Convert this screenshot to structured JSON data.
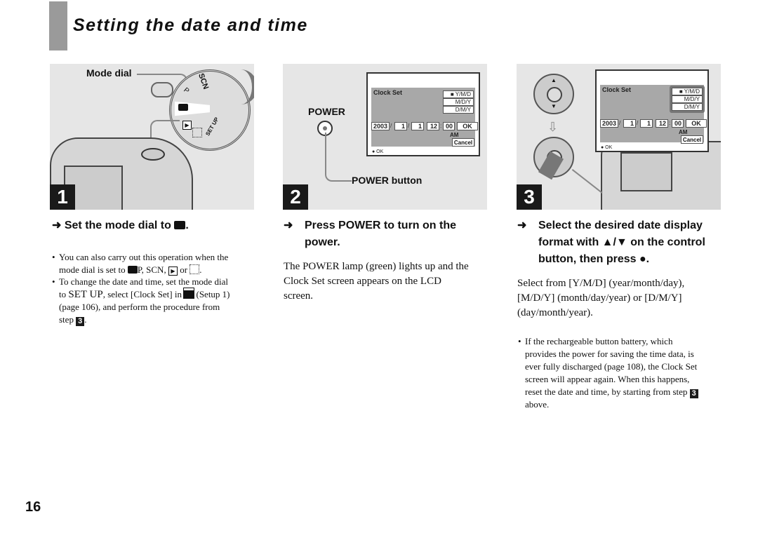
{
  "page": {
    "title": "Setting the date and time",
    "page_number": "16"
  },
  "steps": [
    {
      "number": "1",
      "illustration_label": "Mode dial",
      "dial_labels": [
        "SCN",
        "P",
        "SET UP"
      ],
      "heading": "Set the mode dial to",
      "heading_icon": "camera-icon",
      "heading_end": ".",
      "bullets": [
        {
          "line1": "You can also carry out this operation when the",
          "line2": "mode dial is set to",
          "line2_rest": "P, SCN,",
          "line2_or": "or",
          "line2_end": "."
        },
        {
          "line1": "To change the date and time, set the mode dial",
          "line2a": "to",
          "line2_setup": "SET UP",
          "line2b": ", select [Clock Set] in",
          "line2c": "(Setup 1)",
          "line3": "(page 106), and perform the procedure from",
          "line4": "step",
          "step_ref": "3",
          "line4_end": "."
        }
      ]
    },
    {
      "number": "2",
      "power_label": "POWER",
      "power_button_label": "POWER button",
      "heading_line1": "Press POWER to turn on the",
      "heading_line2": "power.",
      "body": [
        "The POWER lamp (green) lights up and the",
        "Clock Set screen appears on the LCD",
        "screen."
      ]
    },
    {
      "number": "3",
      "heading_lines": [
        "Select the desired date display",
        "format with ▲/▼ on the control",
        "button, then press ●."
      ],
      "body": [
        "Select from [Y/M/D] (year/month/day),",
        "[M/D/Y] (month/day/year) or [D/M/Y]",
        "(day/month/year)."
      ],
      "note": {
        "lines": [
          "If the rechargeable button battery, which",
          "provides the power for saving the time data, is",
          "ever fully discharged (page 108), the Clock Set",
          "screen will appear again. When this happens,",
          "reset the date and time, by starting from step"
        ],
        "step_ref": "3",
        "last_line": "above."
      }
    }
  ],
  "clock_set_screen": {
    "title": "Clock Set",
    "formats": [
      "■ Y/M/D",
      "M/D/Y",
      "D/M/Y"
    ],
    "selected_format": "Y/M/D",
    "year": "2003",
    "month": "1",
    "day": "1",
    "hour": "12",
    "minute": "00",
    "ok": "OK",
    "ampm": "AM",
    "cancel": "Cancel",
    "footer": "● OK",
    "slash": "/",
    "colon": ":"
  },
  "arrow_glyph": "➜"
}
